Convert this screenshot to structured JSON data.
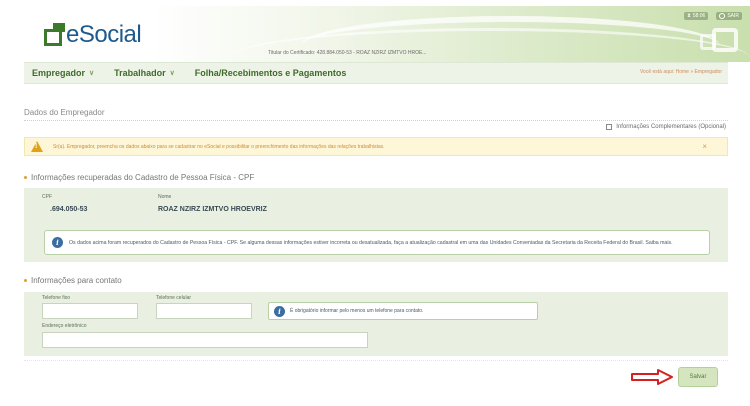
{
  "header": {
    "logo_text": "eSocial",
    "certificate_line": "Titular do Certificado: 428.884.050-53 - ROAZ NZIRZ IZMTVO HROE...",
    "timer": "58:06",
    "logout_label": "SAIR"
  },
  "nav": {
    "items": [
      {
        "label": "Empregador",
        "has_menu": true
      },
      {
        "label": "Trabalhador",
        "has_menu": true
      },
      {
        "label": "Folha/Recebimentos e Pagamentos",
        "has_menu": false
      }
    ],
    "breadcrumb_prefix": "Você está aqui:",
    "breadcrumb_home": "Home",
    "breadcrumb_separator": "»",
    "breadcrumb_current": "Empregador"
  },
  "page": {
    "title": "Dados do Empregador",
    "complementary_label": "Informações Complementares (Opcional)"
  },
  "alert": {
    "text": "Sr(a). Empregador, preencha os dados abaixo para se cadastrar no eSocial e possibilitar o preenchimento das informações das relações trabalhistas.",
    "close": "×"
  },
  "cpf_section": {
    "title": "Informações recuperadas do Cadastro de Pessoa Física - CPF",
    "cpf_label": "CPF",
    "cpf_value": ".694.050-53",
    "name_label": "Nome",
    "name_value": "ROAZ NZIRZ IZMTVO HROEVRIZ",
    "info_text": "Os dados acima foram recuperados do Cadastro de Pessoa Física - CPF. Se alguma dessas informações estiver incorreta ou desatualizada, faça a atualização cadastral em uma das Unidades Conveniadas da Secretaria da Receita Federal do Brasil. Saiba mais."
  },
  "contact_section": {
    "title": "Informações para contato",
    "phone_label": "Telefone fixo",
    "phone_value": "",
    "mobile_label": "Telefone celular",
    "mobile_value": "",
    "required_info": "É obrigatório informar pelo menos um telefone para contato.",
    "email_label": "Endereço eletrônico",
    "email_value": ""
  },
  "footer": {
    "save_label": "Salvar"
  },
  "colors": {
    "brand_green": "#3a7a2a",
    "brand_blue": "#1f5a8c",
    "panel_bg": "#e9f0e2",
    "alert_bg": "#fdf7d8",
    "arrow_red": "#d42020"
  }
}
